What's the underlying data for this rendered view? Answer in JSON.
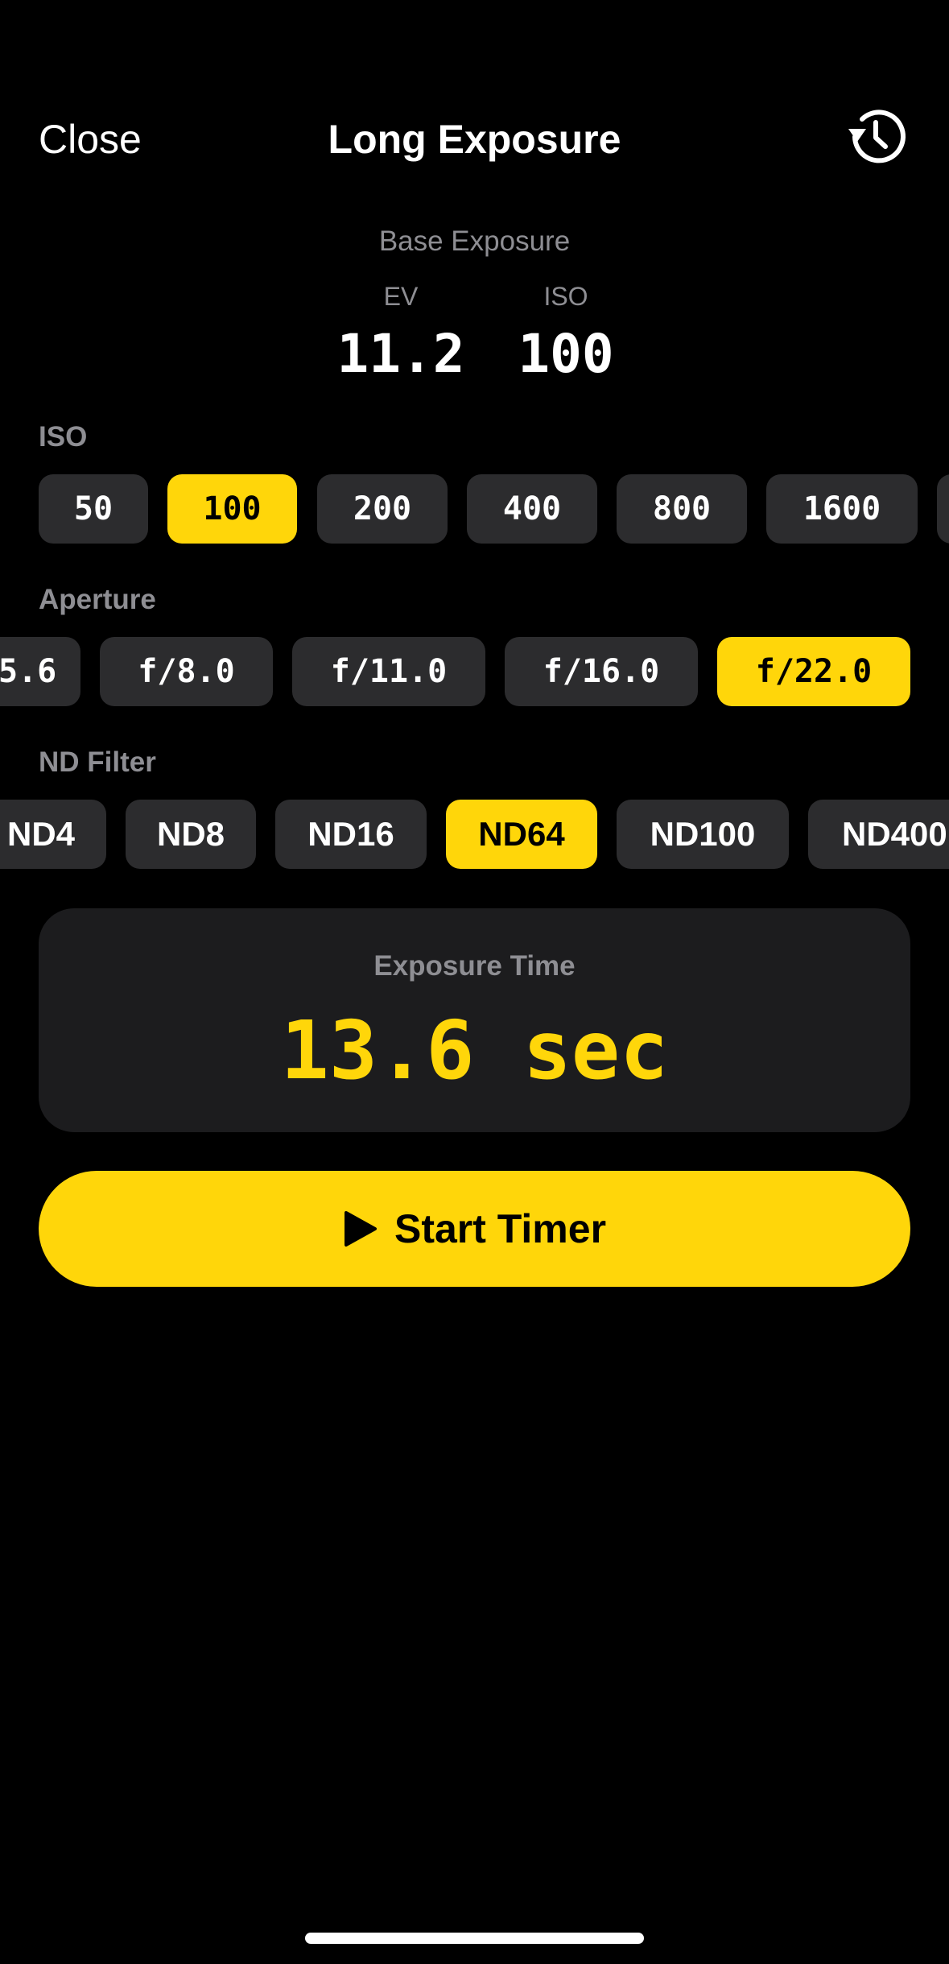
{
  "nav": {
    "close_label": "Close",
    "title": "Long Exposure",
    "history_icon": "history-icon"
  },
  "base_exposure": {
    "label": "Base Exposure",
    "ev_label": "EV",
    "ev_value": "11.2",
    "iso_label": "ISO",
    "iso_value": "100"
  },
  "iso": {
    "label": "ISO",
    "options": [
      "50",
      "100",
      "200",
      "400",
      "800",
      "1600"
    ],
    "selected": "100"
  },
  "aperture": {
    "label": "Aperture",
    "options": [
      "5.6",
      "f/8.0",
      "f/11.0",
      "f/16.0",
      "f/22.0"
    ],
    "selected": "f/22.0"
  },
  "nd_filter": {
    "label": "ND Filter",
    "options": [
      "ND4",
      "ND8",
      "ND16",
      "ND64",
      "ND100",
      "ND400"
    ],
    "selected": "ND64"
  },
  "exposure_time": {
    "label": "Exposure Time",
    "value": "13.6 sec"
  },
  "start_button": {
    "label": "Start Timer",
    "icon": "play-icon"
  },
  "colors": {
    "accent": "#ffd60a",
    "chip_bg": "#2c2c2e",
    "card_bg": "#1c1c1e",
    "secondary_text": "#8e8e93"
  }
}
